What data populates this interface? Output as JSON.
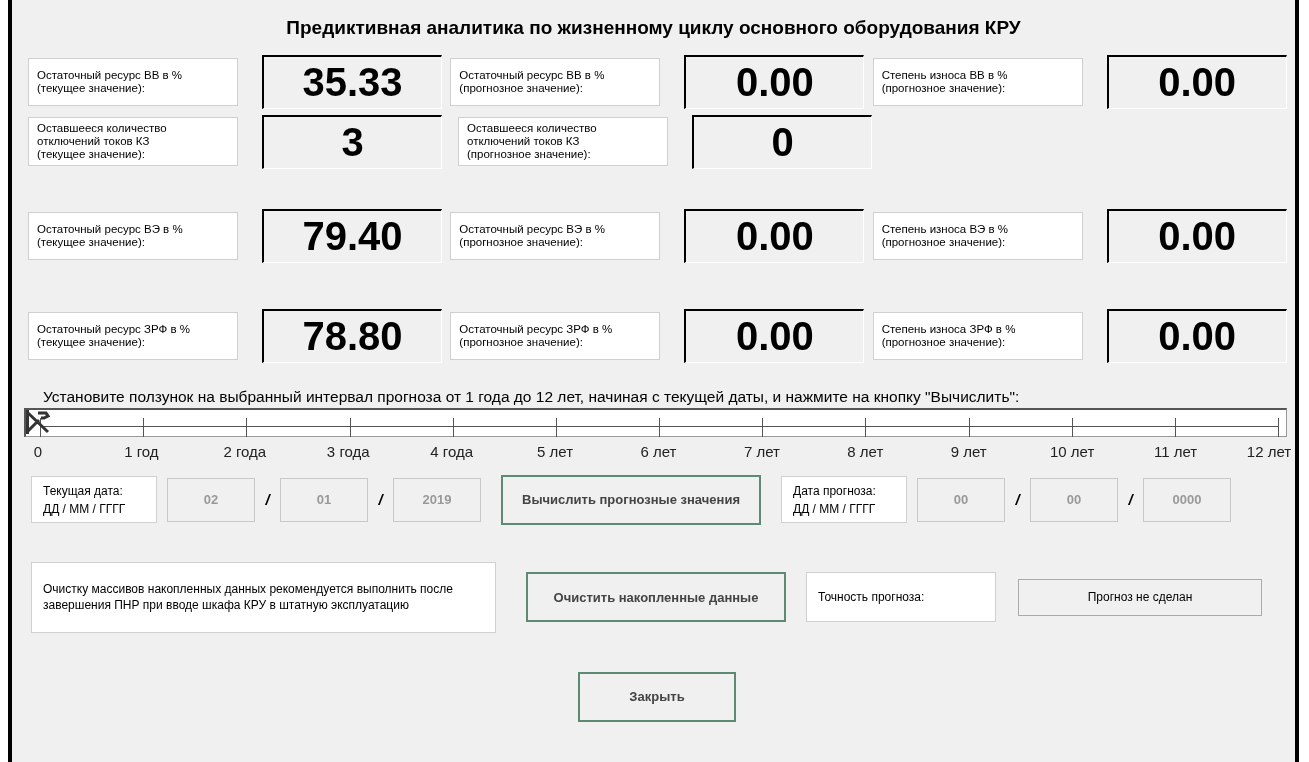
{
  "title": "Предиктивная аналитика по жизненному циклу основного оборудования КРУ",
  "metric_rows": [
    {
      "cells": [
        {
          "label": "Остаточный ресурс ВВ в %\n(текущее значение):",
          "value": "35.33"
        },
        {
          "label": "Остаточный ресурс ВВ в %\n(прогнозное значение):",
          "value": "0.00"
        },
        {
          "label": "Степень износа ВВ в %\n(прогнозное значение):",
          "value": "0.00"
        }
      ]
    },
    {
      "cells": [
        {
          "label": "Оставшееся количество\nотключений токов КЗ\n(текущее значение):",
          "value": "3"
        },
        {
          "label": "Оставшееся количество\nотключений токов КЗ\n(прогнозное значение):",
          "value": "0"
        }
      ]
    },
    {
      "cells": [
        {
          "label": "Остаточный ресурс ВЭ в %\n(текущее значение):",
          "value": "79.40"
        },
        {
          "label": "Остаточный ресурс ВЭ в %\n(прогнозное значение):",
          "value": "0.00"
        },
        {
          "label": "Степень износа ВЭ в %\n(прогнозное значение):",
          "value": "0.00"
        }
      ]
    },
    {
      "cells": [
        {
          "label": "Остаточный ресурс ЗРФ в %\n(текущее значение):",
          "value": "78.80"
        },
        {
          "label": "Остаточный ресурс ЗРФ в %\n(прогнозное значение):",
          "value": "0.00"
        },
        {
          "label": "Степень износа ЗРФ в %\n(прогнозное значение):",
          "value": "0.00"
        }
      ]
    }
  ],
  "slider": {
    "instruction": "Установите ползунок на выбранный интервал прогноза от 1 года до 12 лет, начиная с текущей даты, и нажмите на кнопку \"Вычислить\":",
    "level": 0,
    "ticks": [
      "0",
      "1 год",
      "2 года",
      "3 года",
      "4 года",
      "5 лет",
      "6 лет",
      "7 лет",
      "8 лет",
      "9 лет",
      "10 лет",
      "11 лет",
      "12 лет"
    ]
  },
  "current_date": {
    "label": "Текущая дата:\nДД / ММ / ГГГГ",
    "fields": [
      "02",
      "01",
      "2019"
    ],
    "separators": [
      "/",
      "/"
    ]
  },
  "compute_button": "Вычислить прогнозные значения",
  "forecast_date": {
    "label": "Дата прогноза:\nДД / ММ / ГГГГ",
    "fields": [
      "00",
      "00",
      "0000"
    ],
    "separators": [
      "/",
      "/"
    ]
  },
  "clear_note": "Очистку массивов накопленных данных рекомендуется выполнить после завершения ПНР при вводе шкафа КРУ в штатную эксплуатацию",
  "clear_button": "Очистить накопленные данные",
  "accuracy": {
    "label": "Точность прогноза:",
    "value": "Прогноз не сделан"
  },
  "close_button": "Закрыть"
}
